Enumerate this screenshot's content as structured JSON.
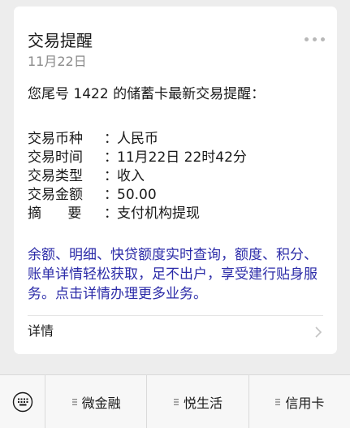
{
  "card": {
    "title": "交易提醒",
    "date": "11月22日",
    "intro": "您尾号 1422 的储蓄卡最新交易提醒：",
    "fields": [
      {
        "label": "交易币种",
        "value": "人民币"
      },
      {
        "label": "交易时间",
        "value": "11月22日 22时42分"
      },
      {
        "label": "交易类型",
        "value": "收入"
      },
      {
        "label": "交易金额",
        "value": "50.00"
      },
      {
        "label": "摘      要",
        "value": "支付机构提现"
      }
    ],
    "field_separator": "：",
    "promo": "余额、明细、快贷额度实时查询，额度、积分、账单详情轻松获取，足不出户，享受建行贴身服务。点击详情办理更多业务。",
    "details_label": "详情",
    "more_icon": "more-dots-icon",
    "details_icon": "chevron-right-icon"
  },
  "bottom_bar": {
    "keyboard_icon": "keyboard-icon",
    "menus": [
      {
        "label": "微金融",
        "icon": "menu-lines-icon"
      },
      {
        "label": "悦生活",
        "icon": "menu-lines-icon"
      },
      {
        "label": "信用卡",
        "icon": "menu-lines-icon"
      }
    ]
  },
  "colors": {
    "background": "#ededed",
    "card": "#ffffff",
    "promo_text": "#2b2ba8",
    "muted_text": "#8a8a8a",
    "bottom_bar": "#f7f7f7"
  }
}
